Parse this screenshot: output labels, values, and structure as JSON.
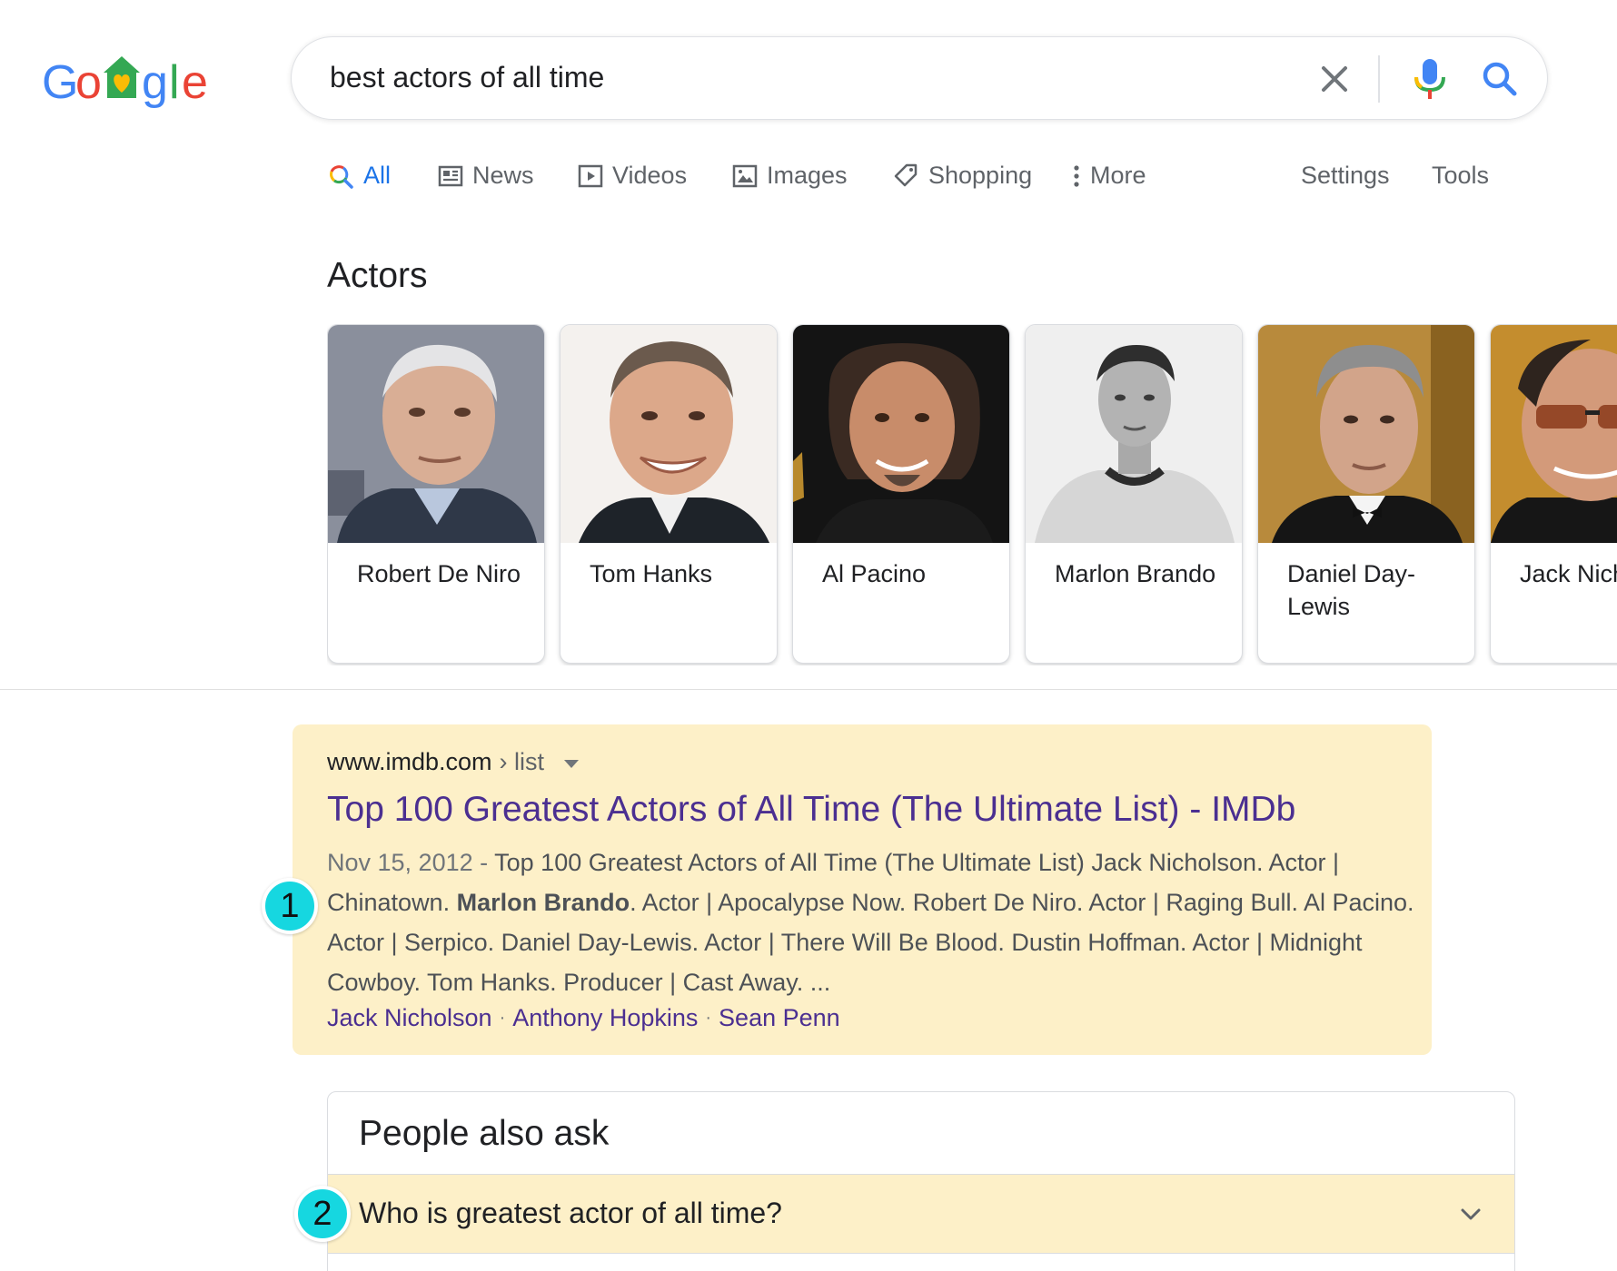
{
  "logo": {
    "text": "Google"
  },
  "search": {
    "query": "best actors of all time"
  },
  "tabs": [
    {
      "label": "All",
      "icon": "search-icon",
      "active": true
    },
    {
      "label": "News",
      "icon": "news-icon"
    },
    {
      "label": "Videos",
      "icon": "video-icon"
    },
    {
      "label": "Images",
      "icon": "image-icon"
    },
    {
      "label": "Shopping",
      "icon": "tag-icon"
    },
    {
      "label": "More",
      "icon": "more-vert-icon"
    },
    {
      "label": "Settings"
    },
    {
      "label": "Tools"
    }
  ],
  "actors": {
    "title": "Actors",
    "items": [
      {
        "name": "Robert De Niro"
      },
      {
        "name": "Tom Hanks"
      },
      {
        "name": "Al Pacino"
      },
      {
        "name": "Marlon Brando"
      },
      {
        "name": "Daniel Day-Lewis"
      },
      {
        "name": "Jack Nicholson"
      }
    ]
  },
  "result": {
    "domain": "www.imdb.com",
    "path": "› list",
    "title": "Top 100 Greatest Actors of All Time (The Ultimate List) - IMDb",
    "date": "Nov 15, 2012",
    "date_sep": " - ",
    "snippet_pre": "Top 100 Greatest Actors of All Time (The Ultimate List) Jack Nicholson. Actor | Chinatown. ",
    "snippet_bold": "Marlon Brando",
    "snippet_post": ". Actor | Apocalypse Now. Robert De Niro. Actor | Raging Bull. Al Pacino. Actor | Serpico. Daniel Day-Lewis. Actor | There Will Be Blood. Dustin Hoffman. Actor | Midnight Cowboy. Tom Hanks. Producer | Cast Away. ...",
    "sitelinks": [
      "Jack Nicholson",
      "Anthony Hopkins",
      "Sean Penn"
    ],
    "sitelink_sep": "·"
  },
  "paa": {
    "heading": "People also ask",
    "questions": [
      "Who is greatest actor of all time?"
    ]
  },
  "badges": [
    "1",
    "2"
  ],
  "colors": {
    "highlight": "#fdf0c8",
    "badge": "#16d7e0",
    "link": "#4b2f91",
    "active_tab": "#1a73e8"
  }
}
